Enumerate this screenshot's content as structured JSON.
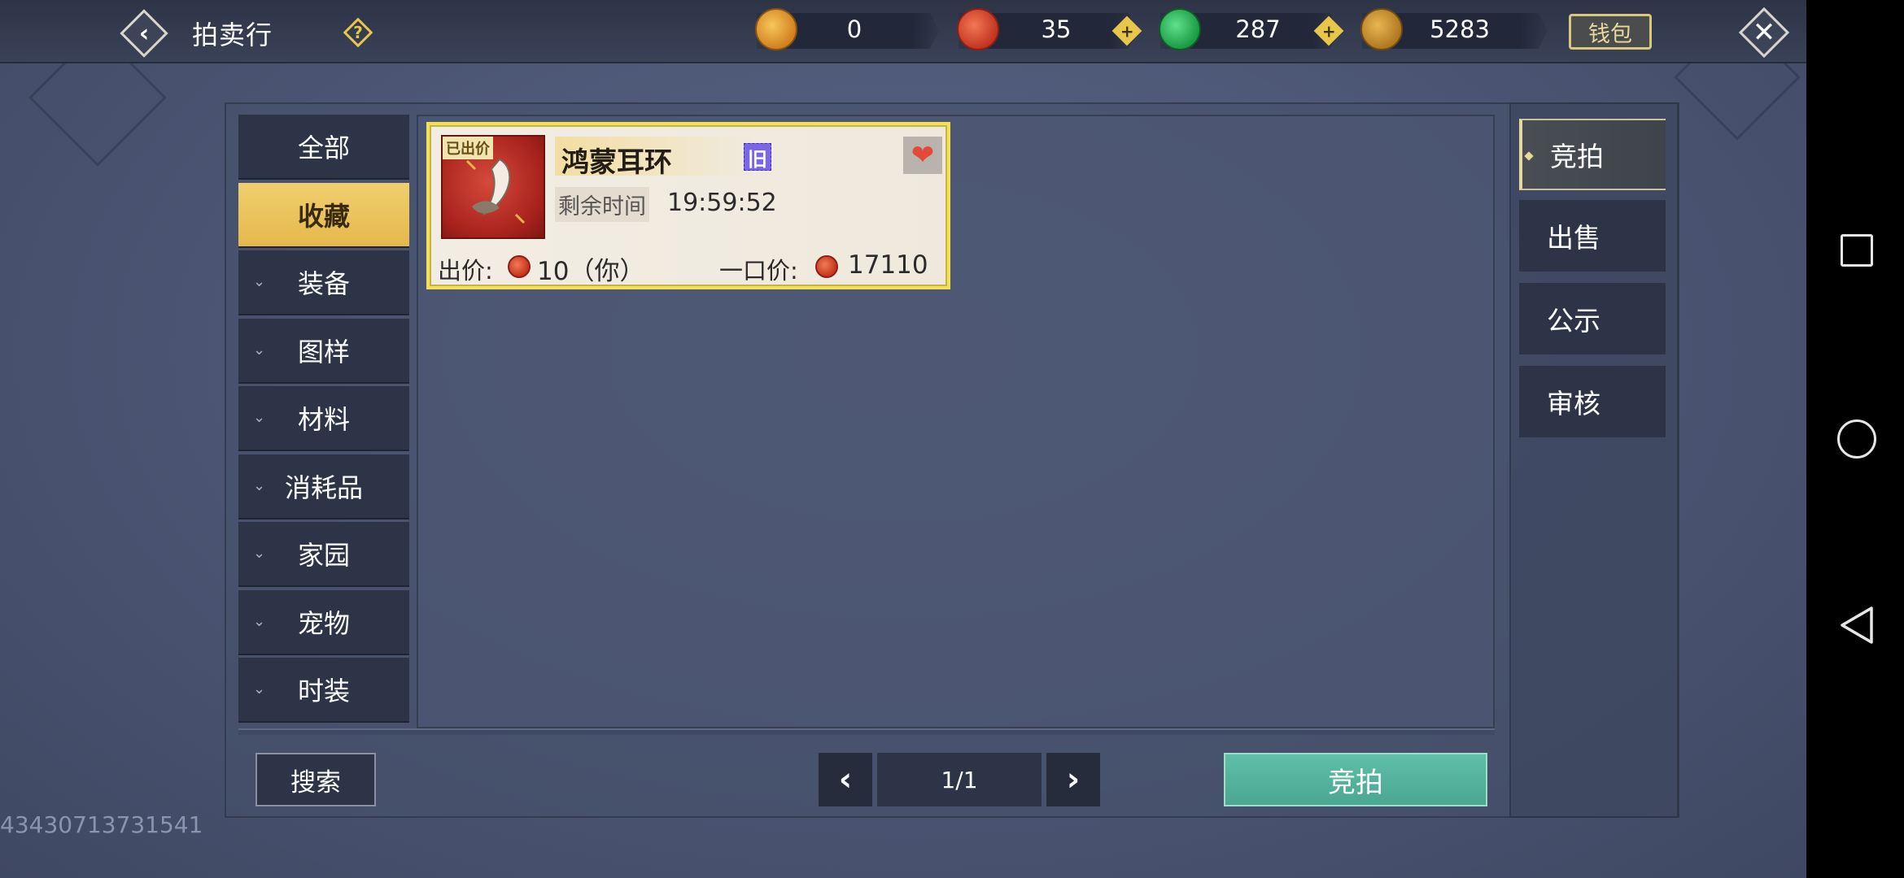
{
  "header": {
    "back_icon": "‹",
    "title": "拍卖行",
    "help_icon": "?",
    "currencies": [
      {
        "name": "gold-ingot-icon",
        "value": "0",
        "color": "#e9a13a"
      },
      {
        "name": "red-jade-icon",
        "value": "35",
        "color": "#d13b25",
        "plus": true
      },
      {
        "name": "green-jade-icon",
        "value": "287",
        "color": "#22a64a",
        "plus": true
      },
      {
        "name": "gold-leaf-icon",
        "value": "5283",
        "color": "#c9912e"
      }
    ],
    "plus_icon": "+",
    "wallet_label": "钱包",
    "close_icon": "✕"
  },
  "categories": [
    {
      "label": "全部",
      "active": false,
      "expandable": false
    },
    {
      "label": "收藏",
      "active": true,
      "expandable": false
    },
    {
      "label": "装备",
      "active": false,
      "expandable": true
    },
    {
      "label": "图样",
      "active": false,
      "expandable": true
    },
    {
      "label": "材料",
      "active": false,
      "expandable": true
    },
    {
      "label": "消耗品",
      "active": false,
      "expandable": true
    },
    {
      "label": "家园",
      "active": false,
      "expandable": true
    },
    {
      "label": "宠物",
      "active": false,
      "expandable": true
    },
    {
      "label": "时装",
      "active": false,
      "expandable": true
    }
  ],
  "chevron_icon": "⌄",
  "item_card": {
    "status_tag": "已出价",
    "name": "鸿蒙耳环",
    "old_tag": "旧",
    "favorite_icon": "❤",
    "time_label": "剩余时间",
    "time_value": "19:59:52",
    "bid_label": "出价:",
    "bid_value": "10（你）",
    "buyout_label": "一口价:",
    "buyout_value": "17110"
  },
  "bottom": {
    "search_label": "搜索",
    "prev_icon": "‹",
    "page": "1/1",
    "next_icon": "›",
    "auction_label": "竞拍"
  },
  "right_tabs": [
    {
      "label": "竞拍",
      "active": true
    },
    {
      "label": "出售",
      "active": false
    },
    {
      "label": "公示",
      "active": false
    },
    {
      "label": "审核",
      "active": false
    }
  ],
  "uid_text": "43430713731541"
}
